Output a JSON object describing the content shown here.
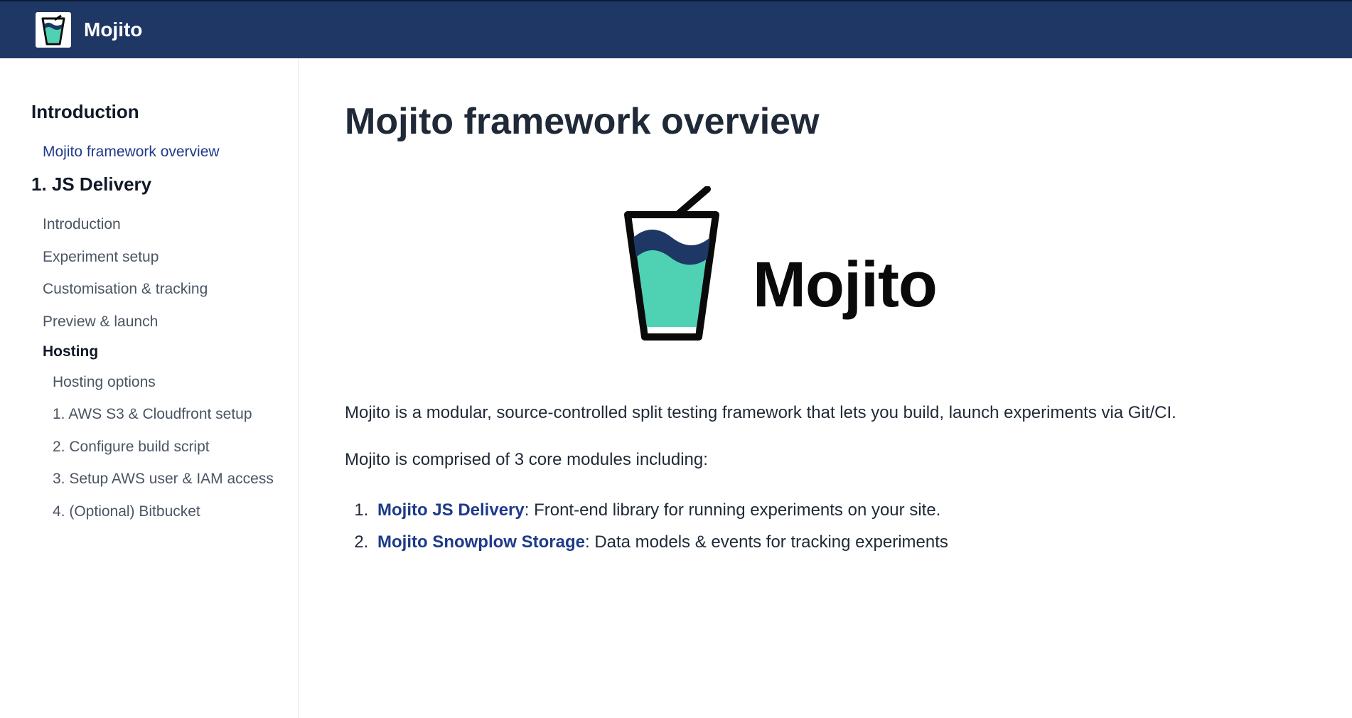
{
  "header": {
    "brand": "Mojito"
  },
  "sidebar": {
    "sections": [
      {
        "title": "Introduction",
        "items": [
          {
            "label": "Mojito framework overview",
            "active": true
          }
        ]
      },
      {
        "title": "1. JS Delivery",
        "items": [
          {
            "label": "Introduction"
          },
          {
            "label": "Experiment setup"
          },
          {
            "label": "Customisation & tracking"
          },
          {
            "label": "Preview & launch"
          },
          {
            "label": "Hosting",
            "subheading": true
          },
          {
            "label": "Hosting options",
            "indent": true
          },
          {
            "label": "1. AWS S3 & Cloudfront setup",
            "indent": true
          },
          {
            "label": "2. Configure build script",
            "indent": true
          },
          {
            "label": "3. Setup AWS user & IAM access",
            "indent": true
          },
          {
            "label": "4. (Optional) Bitbucket",
            "indent": true
          }
        ]
      }
    ]
  },
  "main": {
    "title": "Mojito framework overview",
    "hero_word": "Mojito",
    "intro1": "Mojito is a modular, source-controlled split testing framework that lets you build, launch experiments via Git/CI.",
    "intro2": "Mojito is comprised of 3 core modules including:",
    "modules": [
      {
        "name": "Mojito JS Delivery",
        "desc": ": Front-end library for running experiments on your site."
      },
      {
        "name": "Mojito Snowplow Storage",
        "desc": ": Data models & events for tracking experiments"
      }
    ]
  },
  "colors": {
    "header_bg": "#1e3765",
    "link_active": "#1e3a8a",
    "logo_liquid": "#4fd1b3",
    "logo_wave": "#1e3765"
  }
}
